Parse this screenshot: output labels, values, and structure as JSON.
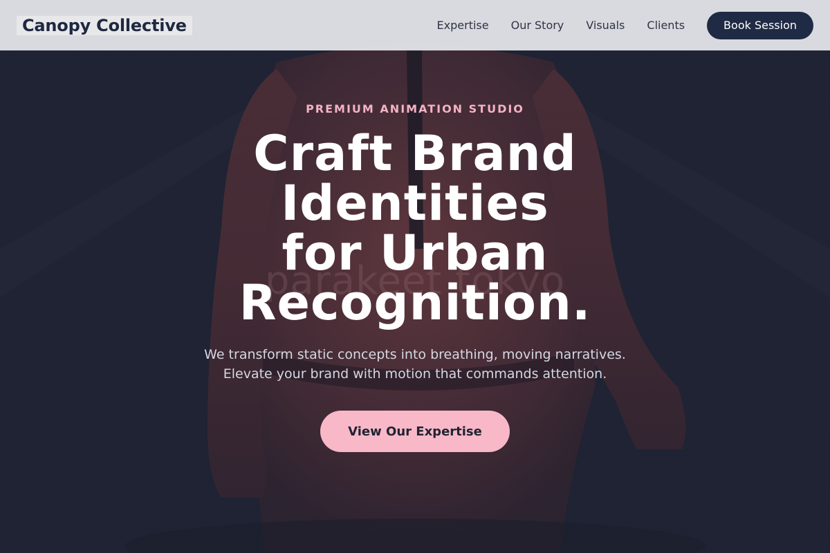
{
  "navbar": {
    "brand": "Canopy Collective",
    "links": [
      "Expertise",
      "Our Story",
      "Visuals",
      "Clients"
    ],
    "cta_label": "Book Session"
  },
  "hero": {
    "watermark": "parakeet tokyo",
    "eyebrow": "PREMIUM ANIMATION STUDIO",
    "headline_lines": [
      "Craft Brand",
      "Identities",
      "for Urban",
      "Recognition."
    ],
    "subtext_lines": [
      "We transform static concepts into breathing, moving narratives.",
      "Elevate your brand with motion that commands attention."
    ],
    "cta_label": "View Our Expertise"
  },
  "colors": {
    "background": "#1f2333",
    "navbar": "#e4e5e9",
    "accent_pink": "#f8b8c8",
    "eyebrow_pink": "#f4b3c4",
    "dark_navy": "#1f2a44"
  }
}
